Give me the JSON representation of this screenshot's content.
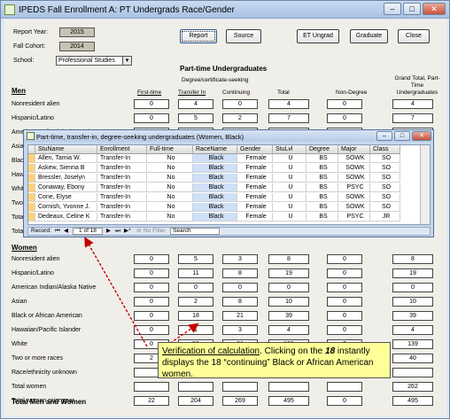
{
  "window": {
    "title": "IPEDS Fall Enrollment A: PT Undergrads Race/Gender",
    "controls": [
      "–",
      "□",
      "✕"
    ]
  },
  "form": {
    "report_year_label": "Report Year:",
    "report_year": "2015",
    "fall_cohort_label": "Fall Cohort:",
    "fall_cohort": "2014",
    "school_label": "School:",
    "school": "Professional Studies",
    "buttons": {
      "report": "Report",
      "source": "Source",
      "et_ungrad": "ET Ungrad",
      "graduate": "Graduate",
      "close": "Close"
    },
    "section_title": "Part-time Undergraduates",
    "degree_group": "Degree/certificate-seeking",
    "col_first_time": "First-time",
    "col_transfer_in": "Transfer In",
    "col_continuing": "Continuing",
    "col_total": "Total",
    "col_non_degree": "Non-Degree",
    "col_grand_total": "Grand Total, Part-Time Undergraduates",
    "men_label": "Men",
    "women_label": "Women",
    "total_label": "Total Men and Women"
  },
  "men_rows": [
    {
      "label": "Nonresident alien",
      "values": [
        "0",
        "4",
        "0",
        "4",
        "0",
        "4"
      ]
    },
    {
      "label": "Hispanic/Latino",
      "values": [
        "0",
        "5",
        "2",
        "7",
        "0",
        "7"
      ]
    },
    {
      "label": "American Indian/Alaska Native",
      "values": [
        "0",
        "1",
        "3",
        "8",
        "0",
        "8"
      ]
    },
    {
      "label": "Asian",
      "values": [
        "",
        "",
        "",
        "",
        "",
        ""
      ]
    },
    {
      "label": "Black or African American",
      "values": [
        "",
        "",
        "",
        "",
        "",
        ""
      ]
    },
    {
      "label": "Hawaiian/Pacific Islander",
      "values": [
        "",
        "",
        "",
        "",
        "",
        ""
      ]
    },
    {
      "label": "White",
      "values": [
        "",
        "",
        "",
        "",
        "",
        ""
      ]
    },
    {
      "label": "Two or more races",
      "values": [
        "",
        "",
        "",
        "",
        "",
        ""
      ]
    },
    {
      "label": "Total",
      "values": [
        "",
        "",
        "",
        "",
        "",
        ""
      ]
    },
    {
      "label": "Total",
      "values": [
        "",
        "",
        "",
        "",
        "",
        ""
      ]
    }
  ],
  "women_rows": [
    {
      "label": "Nonresident alien",
      "values": [
        "0",
        "5",
        "3",
        "8",
        "0",
        "8"
      ]
    },
    {
      "label": "Hispanic/Latino",
      "values": [
        "0",
        "11",
        "8",
        "19",
        "0",
        "19"
      ]
    },
    {
      "label": "American Indian/Alaska Native",
      "values": [
        "0",
        "0",
        "0",
        "0",
        "0",
        "0"
      ]
    },
    {
      "label": "Asian",
      "values": [
        "0",
        "2",
        "8",
        "10",
        "0",
        "10"
      ]
    },
    {
      "label": "Black or African American",
      "values": [
        "0",
        "18",
        "21",
        "39",
        "0",
        "39"
      ]
    },
    {
      "label": "Hawaiian/Pacific Islander",
      "values": [
        "0",
        "1",
        "3",
        "4",
        "0",
        "4"
      ]
    },
    {
      "label": "White",
      "values": [
        "0",
        "58",
        "81",
        "139",
        "0",
        "139"
      ]
    },
    {
      "label": "Two or more races",
      "values": [
        "2",
        "13",
        "25",
        "40",
        "0",
        "40"
      ]
    },
    {
      "label": "Race/ethnicity unknown",
      "values": [
        "",
        "",
        "",
        "",
        "",
        ""
      ]
    },
    {
      "label": "Total women",
      "values": [
        "",
        "",
        "",
        "",
        "",
        "262"
      ]
    },
    {
      "label": "Total women prior year",
      "values": [
        "",
        "",
        "",
        "",
        "",
        "266"
      ]
    }
  ],
  "grand_total": {
    "values": [
      "22",
      "204",
      "269",
      "495",
      "0",
      "495"
    ]
  },
  "popup": {
    "title": "Part-time, transfer-in, degree-seeking undergraduates (Women, Black)",
    "headers": [
      "StuName",
      "Enrollment",
      "Full-time",
      "RaceName",
      "Gender",
      "StuLvl",
      "Degree",
      "Major",
      "Class"
    ],
    "rows": [
      [
        "Allen, Tamia W.",
        "Transfer-In",
        "No",
        "Black",
        "Female",
        "U",
        "BS",
        "SOWK",
        "SO"
      ],
      [
        "Askew, Sienna B",
        "Transfer-In",
        "No",
        "Black",
        "Female",
        "U",
        "BS",
        "SOWK",
        "SO"
      ],
      [
        "Bressler, Joselyn",
        "Transfer-In",
        "No",
        "Black",
        "Female",
        "U",
        "BS",
        "SOWK",
        "SO"
      ],
      [
        "Conaway, Ebony",
        "Transfer-In",
        "No",
        "Black",
        "Female",
        "U",
        "BS",
        "PSYC",
        "SO"
      ],
      [
        "Cone, Elyse",
        "Transfer-In",
        "No",
        "Black",
        "Female",
        "U",
        "BS",
        "SOWK",
        "SO"
      ],
      [
        "Cornish, Yvonne J.",
        "Transfer-In",
        "No",
        "Black",
        "Female",
        "U",
        "BS",
        "SOWK",
        "SO"
      ],
      [
        "Dedeaux, Celine K",
        "Transfer-In",
        "No",
        "Black",
        "Female",
        "U",
        "BS",
        "PSYC",
        "JR"
      ]
    ],
    "nav": {
      "record_label": "Record:",
      "position": "1 of 18",
      "filter": "No Filter",
      "search": "Search"
    }
  },
  "callout": {
    "link_text": "Verification of calculation",
    "text_a": ".  Clicking on the ",
    "num": "18",
    "text_b": " instantly displays the 18 “continuing” Black or African American women."
  },
  "colors": {
    "accent": "#ffd27a",
    "callout": "#ffff99",
    "arrow": "#c00000"
  }
}
